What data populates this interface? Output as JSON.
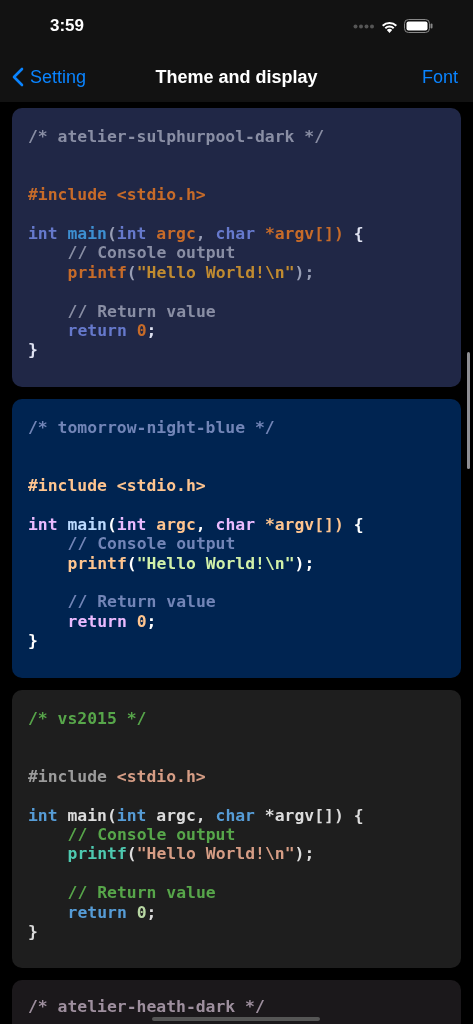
{
  "status_bar": {
    "time": "3:59"
  },
  "nav_bar": {
    "back": "Setting",
    "title": "Theme and display",
    "action": "Font"
  },
  "themes": [
    {
      "color": "#202746",
      "lines": [
        {
          "kind": "code",
          "indented": false,
          "tokens": [
            {
              "text": "/* atelier-sulphurpool-dark */",
              "color": "#898ea4"
            }
          ]
        },
        {
          "kind": "blank"
        },
        {
          "kind": "blank"
        },
        {
          "kind": "code",
          "indented": false,
          "tokens": [
            {
              "text": "#include <stdio.h>",
              "color": "#c76b29"
            }
          ]
        },
        {
          "kind": "blank"
        },
        {
          "kind": "code",
          "indented": false,
          "tokens": [
            {
              "text": "int",
              "color": "#6679cc"
            },
            {
              "text": " main",
              "color": "#3d8fd1"
            },
            {
              "text": "(",
              "color": "#979db4"
            },
            {
              "text": "int",
              "color": "#6679cc"
            },
            {
              "text": " argc",
              "color": "#c76b29"
            },
            {
              "text": ", ",
              "color": "#979db4"
            },
            {
              "text": "char",
              "color": "#6679cc"
            },
            {
              "text": " *argv[])",
              "color": "#c76b29"
            },
            {
              "text": " {",
              "color": "#dfe2f1"
            }
          ]
        },
        {
          "kind": "code",
          "indented": true,
          "tokens": [
            {
              "text": "// Console output",
              "color": "#898ea4"
            }
          ]
        },
        {
          "kind": "code",
          "indented": true,
          "tokens": [
            {
              "text": "printf",
              "color": "#c76b29"
            },
            {
              "text": "(",
              "color": "#979db4"
            },
            {
              "text": "\"Hello World!\\n\"",
              "color": "#c08b30"
            },
            {
              "text": ");",
              "color": "#979db4"
            }
          ]
        },
        {
          "kind": "blank"
        },
        {
          "kind": "code",
          "indented": true,
          "tokens": [
            {
              "text": "// Return value",
              "color": "#898ea4"
            }
          ]
        },
        {
          "kind": "code",
          "indented": true,
          "tokens": [
            {
              "text": "return",
              "color": "#6679cc"
            },
            {
              "text": " 0",
              "color": "#c76b29"
            },
            {
              "text": ";",
              "color": "#dfe2f1"
            }
          ]
        },
        {
          "kind": "code",
          "indented": false,
          "tokens": [
            {
              "text": "}",
              "color": "#dfe2f1"
            }
          ]
        }
      ]
    },
    {
      "color": "#002451",
      "lines": [
        {
          "kind": "code",
          "indented": false,
          "tokens": [
            {
              "text": "/* tomorrow-night-blue */",
              "color": "#7285b7"
            }
          ]
        },
        {
          "kind": "blank"
        },
        {
          "kind": "blank"
        },
        {
          "kind": "code",
          "indented": false,
          "tokens": [
            {
              "text": "#include <stdio.h>",
              "color": "#ffc58f"
            }
          ]
        },
        {
          "kind": "blank"
        },
        {
          "kind": "code",
          "indented": false,
          "tokens": [
            {
              "text": "int",
              "color": "#ebbbff"
            },
            {
              "text": " main",
              "color": "#bbdaff"
            },
            {
              "text": "(",
              "color": "#ffffff"
            },
            {
              "text": "int",
              "color": "#ebbbff"
            },
            {
              "text": " argc",
              "color": "#ffc58f"
            },
            {
              "text": ", ",
              "color": "#ffffff"
            },
            {
              "text": "char",
              "color": "#ebbbff"
            },
            {
              "text": " *argv[])",
              "color": "#ffc58f"
            },
            {
              "text": " {",
              "color": "#ffffff"
            }
          ]
        },
        {
          "kind": "code",
          "indented": true,
          "tokens": [
            {
              "text": "// Console output",
              "color": "#7285b7"
            }
          ]
        },
        {
          "kind": "code",
          "indented": true,
          "tokens": [
            {
              "text": "printf",
              "color": "#ffc58f"
            },
            {
              "text": "(",
              "color": "#ffffff"
            },
            {
              "text": "\"Hello World!\\n\"",
              "color": "#d1f1a9"
            },
            {
              "text": ");",
              "color": "#ffffff"
            }
          ]
        },
        {
          "kind": "blank"
        },
        {
          "kind": "code",
          "indented": true,
          "tokens": [
            {
              "text": "// Return value",
              "color": "#7285b7"
            }
          ]
        },
        {
          "kind": "code",
          "indented": true,
          "tokens": [
            {
              "text": "return",
              "color": "#ebbbff"
            },
            {
              "text": " 0",
              "color": "#ffc58f"
            },
            {
              "text": ";",
              "color": "#ffffff"
            }
          ]
        },
        {
          "kind": "code",
          "indented": false,
          "tokens": [
            {
              "text": "}",
              "color": "#ffffff"
            }
          ]
        }
      ]
    },
    {
      "color": "#1e1e1e",
      "lines": [
        {
          "kind": "code",
          "indented": false,
          "tokens": [
            {
              "text": "/* vs2015 */",
              "color": "#57a64a"
            }
          ]
        },
        {
          "kind": "blank"
        },
        {
          "kind": "blank"
        },
        {
          "kind": "code",
          "indented": false,
          "tokens": [
            {
              "text": "#include",
              "color": "#9b9b9b"
            },
            {
              "text": " <stdio.h>",
              "color": "#d69d85"
            }
          ]
        },
        {
          "kind": "blank"
        },
        {
          "kind": "code",
          "indented": false,
          "tokens": [
            {
              "text": "int",
              "color": "#569cd6"
            },
            {
              "text": " main(",
              "color": "#dcdcdc"
            },
            {
              "text": "int",
              "color": "#569cd6"
            },
            {
              "text": " argc, ",
              "color": "#dcdcdc"
            },
            {
              "text": "char",
              "color": "#569cd6"
            },
            {
              "text": " *argv[]) {",
              "color": "#dcdcdc"
            }
          ]
        },
        {
          "kind": "code",
          "indented": true,
          "tokens": [
            {
              "text": "// Console output",
              "color": "#57a64a"
            }
          ]
        },
        {
          "kind": "code",
          "indented": true,
          "tokens": [
            {
              "text": "printf",
              "color": "#4ec9b0"
            },
            {
              "text": "(",
              "color": "#dcdcdc"
            },
            {
              "text": "\"Hello World!\\n\"",
              "color": "#d69d85"
            },
            {
              "text": ");",
              "color": "#dcdcdc"
            }
          ]
        },
        {
          "kind": "blank"
        },
        {
          "kind": "code",
          "indented": true,
          "tokens": [
            {
              "text": "// Return value",
              "color": "#57a64a"
            }
          ]
        },
        {
          "kind": "code",
          "indented": true,
          "tokens": [
            {
              "text": "return",
              "color": "#569cd6"
            },
            {
              "text": " 0",
              "color": "#b8d7a3"
            },
            {
              "text": ";",
              "color": "#dcdcdc"
            }
          ]
        },
        {
          "kind": "code",
          "indented": false,
          "tokens": [
            {
              "text": "}",
              "color": "#dcdcdc"
            }
          ]
        }
      ]
    },
    {
      "color": "#1b181b",
      "lines": [
        {
          "kind": "code",
          "indented": false,
          "tokens": [
            {
              "text": "/* atelier-heath-dark */",
              "color": "#9e8f9e"
            }
          ]
        }
      ]
    }
  ]
}
